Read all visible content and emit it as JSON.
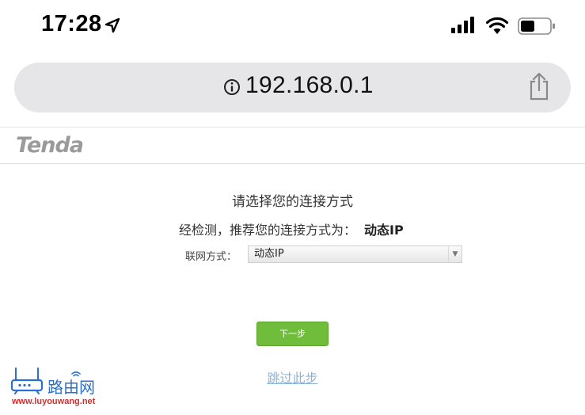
{
  "status_bar": {
    "time": "17:28",
    "icons": [
      "location-arrow-icon",
      "cellular-signal-icon",
      "wifi-icon",
      "battery-icon"
    ]
  },
  "browser": {
    "url": "192.168.0.1",
    "icons": [
      "info-icon",
      "share-icon"
    ]
  },
  "header": {
    "logo": "Tenda"
  },
  "main": {
    "title": "请选择您的连接方式",
    "recommend_text": "经检测，推荐您的连接方式为：",
    "recommend_value": "动态IP",
    "connection_label": "联网方式：",
    "connection_selected": "动态IP",
    "next_button": "下一步",
    "skip_link": "跳过此步"
  },
  "watermark": {
    "logo_text": "路由网",
    "url": "www.luyouwang.net"
  },
  "colors": {
    "url_bar_bg": "#e6e6e9",
    "button_green": "#6fbd3b",
    "link_blue": "#8ab3d6",
    "watermark_blue": "#2b6fd1",
    "watermark_red": "#d12f2f"
  }
}
